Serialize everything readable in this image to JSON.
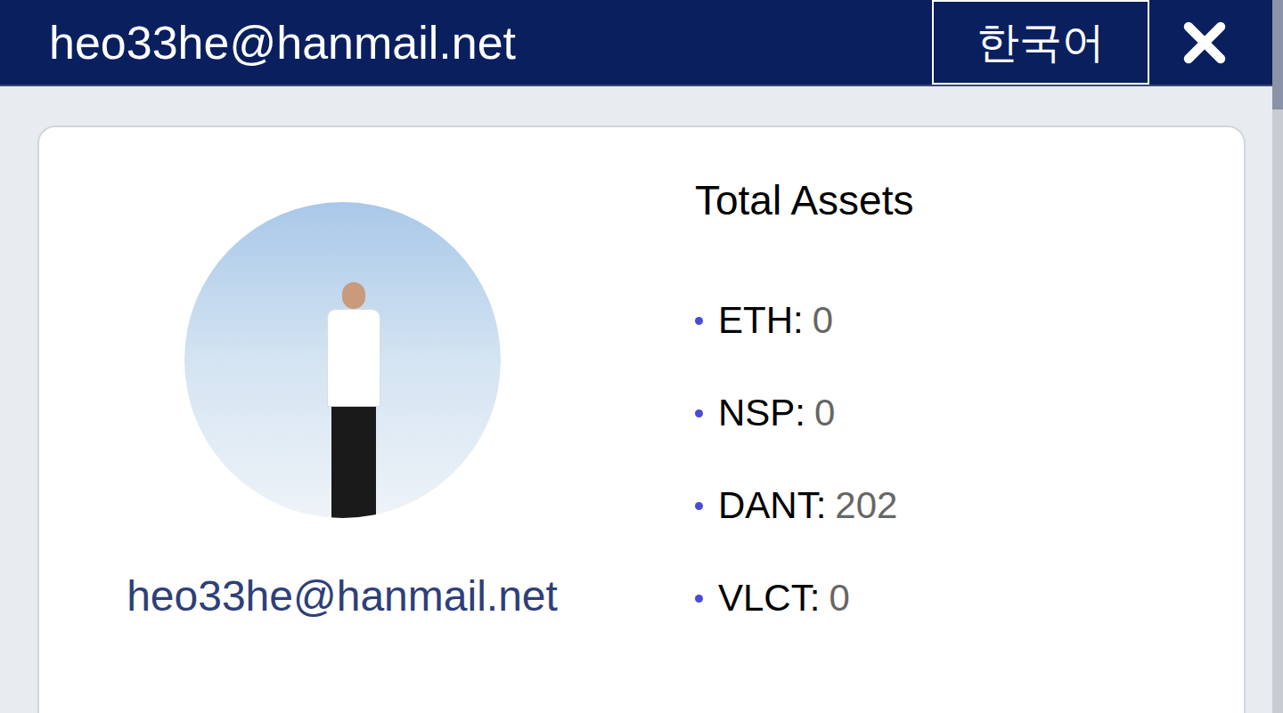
{
  "header": {
    "title": "heo33he@hanmail.net",
    "language_button": "한국어"
  },
  "profile": {
    "email": "heo33he@hanmail.net"
  },
  "assets": {
    "title": "Total Assets",
    "items": [
      {
        "label": "ETH:",
        "value": "0"
      },
      {
        "label": "NSP:",
        "value": "0"
      },
      {
        "label": "DANT:",
        "value": "202"
      },
      {
        "label": "VLCT:",
        "value": "0"
      }
    ]
  }
}
